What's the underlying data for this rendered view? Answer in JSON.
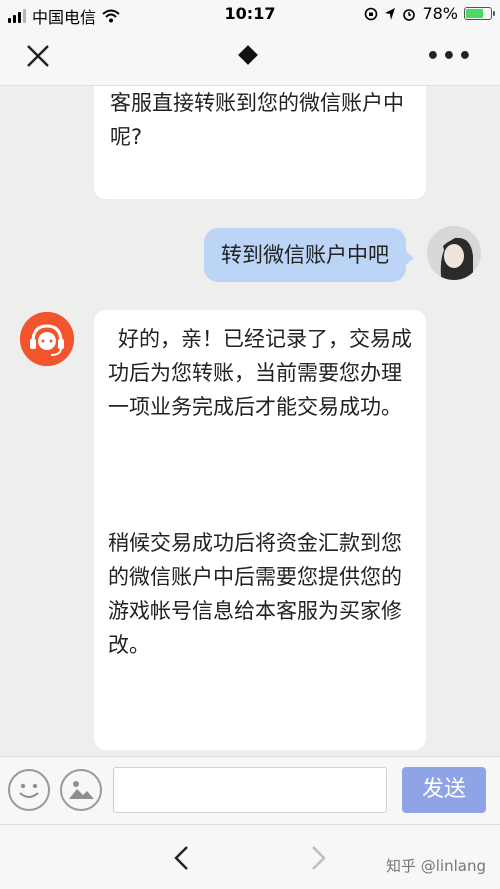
{
  "status": {
    "carrier": "中国电信",
    "time": "10:17",
    "battery_text": "78%",
    "battery_level": 0.78
  },
  "nav": {
    "close_icon": "close-icon",
    "title_icon": "diamond-icon",
    "more_icon": "more-icon"
  },
  "messages": [
    {
      "side": "agent",
      "text": "客服直接转账到您的微信账户中呢?"
    },
    {
      "side": "user",
      "text": "转到微信账户中吧"
    },
    {
      "side": "agent",
      "paragraph1": "好的，亲！已经记录了，交易成功后为您转账，当前需要您办理一项业务完成后才能交易成功。",
      "paragraph2": "稍候交易成功后将资金汇款到您的微信账户中后需要您提供您的游戏帐号信息给本客服为买家修改。"
    }
  ],
  "input": {
    "value": "",
    "placeholder": "",
    "send_label": "发送"
  },
  "footer": {
    "watermark": "知乎 @linlang"
  },
  "colors": {
    "user_bubble": "#bcd4f6",
    "send_button": "#8fa4e6",
    "agent_avatar": "#f2542d"
  }
}
